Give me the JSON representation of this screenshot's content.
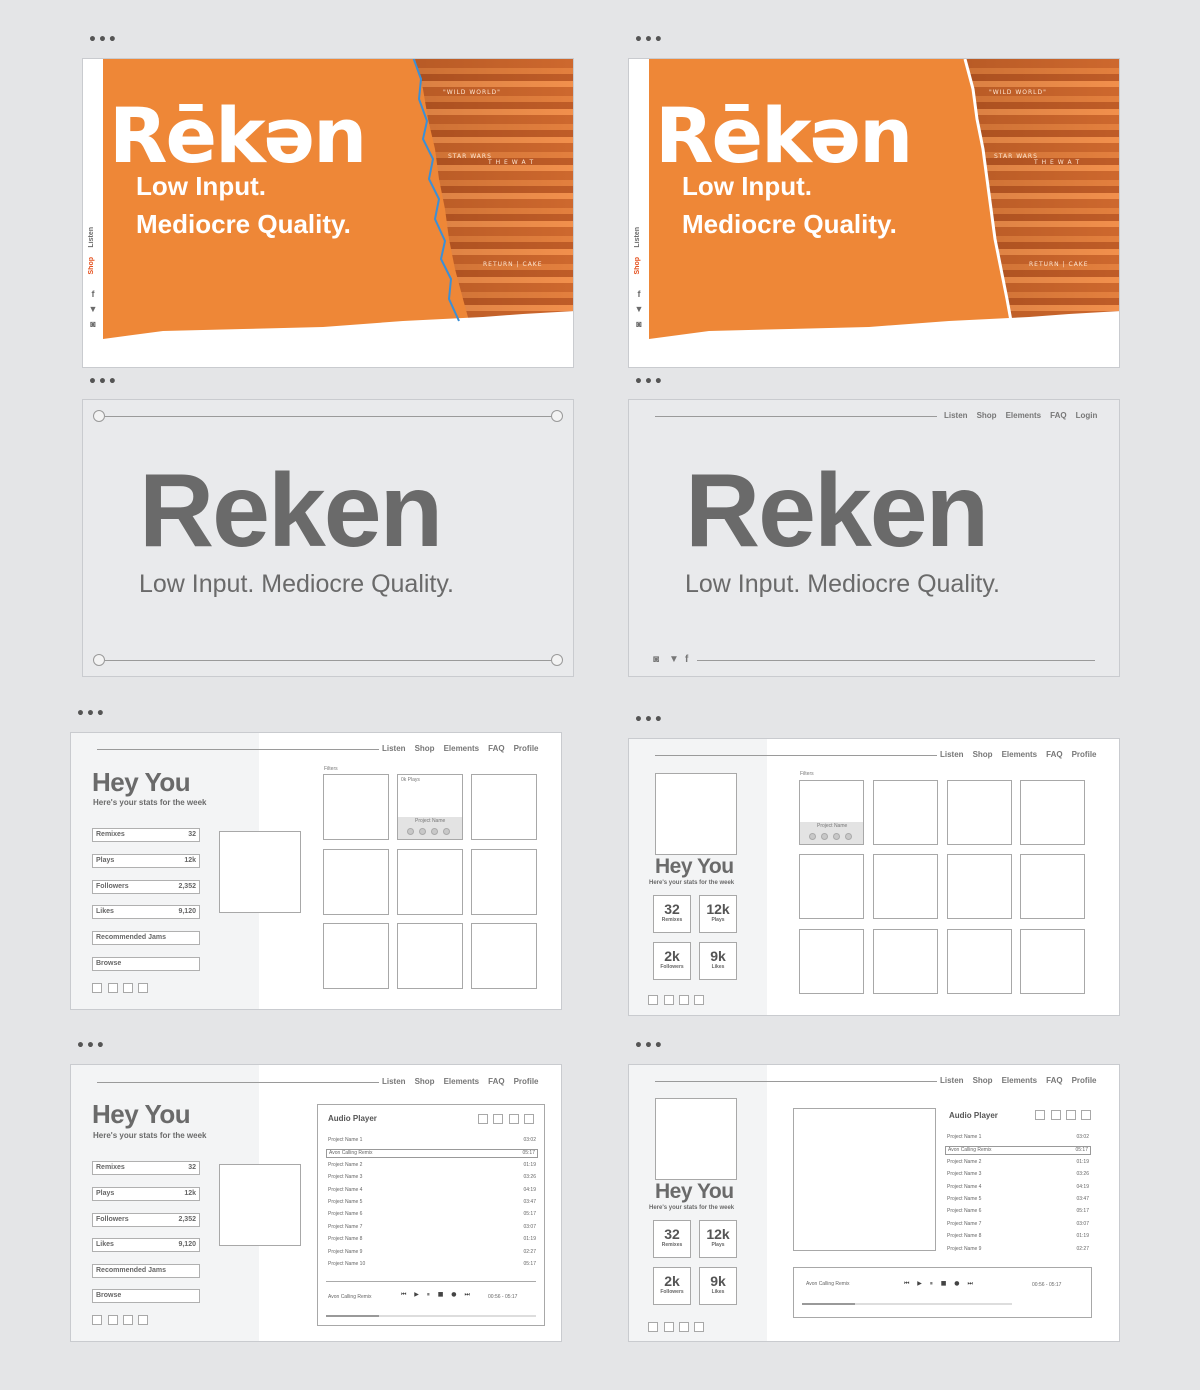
{
  "hero": {
    "logo": "Rēkən",
    "tagline_1": "Low Input.",
    "tagline_2": "Mediocre Quality.",
    "side_nav": [
      "Listen",
      "Shop"
    ],
    "social": [
      "f",
      "t",
      "o"
    ],
    "record_labels": [
      "\"WILD WORLD\"",
      "STAR WARS",
      "T H E  W A T",
      "RETURN | CAKE"
    ],
    "colors": {
      "orange": "#ee8737",
      "accent": "#e5501d",
      "outline": "#3b8fd6"
    }
  },
  "wire_logo": {
    "title": "Reken",
    "tagline": "Low Input. Mediocre Quality.",
    "nav": [
      "Listen",
      "Shop",
      "Elements",
      "FAQ",
      "Login"
    ],
    "social": [
      "o",
      "t",
      "f"
    ]
  },
  "dashboard": {
    "nav": [
      "Listen",
      "Shop",
      "Elements",
      "FAQ",
      "Profile"
    ],
    "greeting": "Hey You",
    "subtitle": "Here's your stats for the week",
    "filters_label": "Filters",
    "tile_plays": "0k Plays",
    "tile_project": "Project Name",
    "stats": [
      {
        "label": "Remixes",
        "value": "32"
      },
      {
        "label": "Plays",
        "value": "12k"
      },
      {
        "label": "Followers",
        "value": "2,352"
      },
      {
        "label": "Likes",
        "value": "9,120"
      }
    ],
    "buttons": [
      "Recommended Jams",
      "Browse"
    ],
    "cards": [
      {
        "value": "32",
        "label": "Remixes"
      },
      {
        "value": "12k",
        "label": "Plays"
      },
      {
        "value": "2k",
        "label": "Followers"
      },
      {
        "value": "9k",
        "label": "Likes"
      }
    ]
  },
  "player": {
    "title": "Audio Player",
    "tracks": [
      {
        "name": "Project Name 1",
        "time": "03:02"
      },
      {
        "name": "Avon Calling Remix",
        "time": "05:17"
      },
      {
        "name": "Project Name 2",
        "time": "01:19"
      },
      {
        "name": "Project Name 3",
        "time": "03:26"
      },
      {
        "name": "Project Name 4",
        "time": "04:19"
      },
      {
        "name": "Project Name 5",
        "time": "03:47"
      },
      {
        "name": "Project Name 6",
        "time": "05:17"
      },
      {
        "name": "Project Name 7",
        "time": "03:07"
      },
      {
        "name": "Project Name 8",
        "time": "01:19"
      },
      {
        "name": "Project Name 9",
        "time": "02:27"
      },
      {
        "name": "Project Name 10",
        "time": "05:17"
      }
    ],
    "now_playing": "Avon Calling Remix",
    "elapsed": "00:56 - 05:17",
    "controls": "⏮ ▶ ⏸ ■ ● ⏭",
    "progress": 0.25
  }
}
